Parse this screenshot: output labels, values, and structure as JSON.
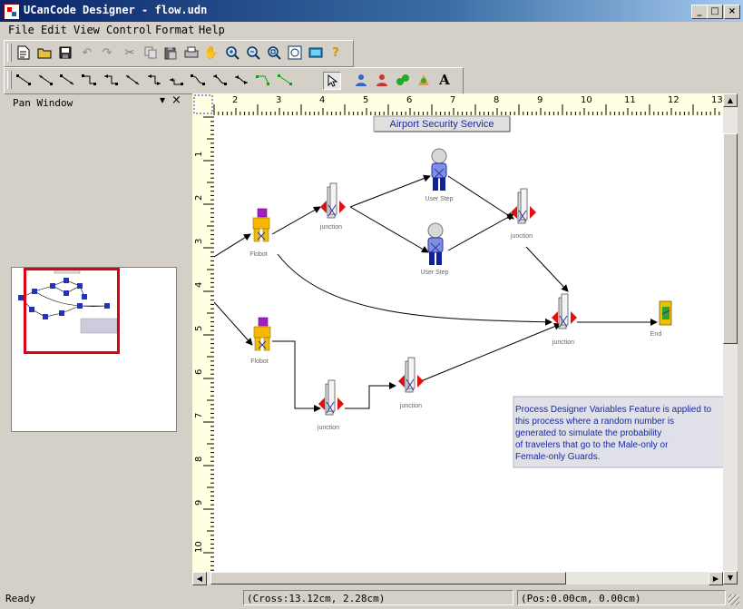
{
  "window": {
    "title": "UCanCode Designer - flow.udn",
    "min": "_",
    "max": "□",
    "close": "×"
  },
  "menu": [
    "File",
    "Edit",
    "View",
    "Control",
    "Format",
    "Help"
  ],
  "toolbar2_text_glyph": "A",
  "pan": {
    "title": "Pan Window",
    "pin": "▾",
    "close": "×"
  },
  "ruler_top": [
    "2",
    "3",
    "4",
    "5",
    "6",
    "7",
    "8",
    "9",
    "10",
    "11",
    "12",
    "13"
  ],
  "ruler_left": [
    "1",
    "2",
    "3",
    "4",
    "5",
    "6",
    "7",
    "8",
    "9",
    "10"
  ],
  "diagram": {
    "title": "Airport Security Service",
    "nodes": {
      "flobot1": "Flobot",
      "flobot2": "Flobot",
      "junction1": "junction",
      "junction2": "junction",
      "junction3": "junction",
      "junction4": "junction",
      "junction5": "junction",
      "userstep1": "User Step",
      "userstep2": "User Step",
      "end": "End"
    },
    "note": [
      "Process Designer Variables Feature  is applied to",
      "this process where a random number is",
      "generated to simulate the probability",
      "of travelers that go to the Male-only or",
      "Female-only Guards."
    ]
  },
  "status": {
    "ready": "Ready",
    "cross": "(Cross:13.12cm, 2.28cm)",
    "pos": "(Pos:0.00cm, 0.00cm)"
  }
}
